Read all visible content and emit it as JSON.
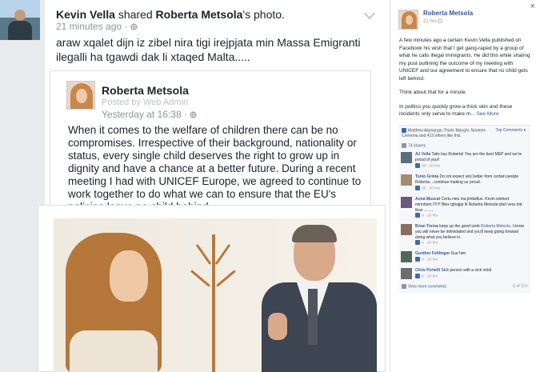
{
  "post": {
    "author": "Kevin Vella",
    "action_prefix": " shared ",
    "shared_from": "Roberta Metsola",
    "action_suffix": "'s photo.",
    "time": "21 minutes ago ·",
    "text": "araw xqalet dijn iz zibel nira tigi irejpjata min Massa Emigranti ilegalli ha tgawdi dak li xtaqed Malta.....",
    "shared": {
      "author": "Roberta Metsola",
      "subtitle": "Posted by Web Admin",
      "time": "Yesterday at 16:38 ·",
      "text": "When it comes to the welfare of children there can be no compromises. Irrespective of their background, nationality or status, every single child deserves the right to grow up in dignity and have a chance at a better future. During a recent meeting I had with UNICEF Europe, we agreed to continue to work together to do what we can to ensure that the EU's policies leave no child behind."
    }
  },
  "panel": {
    "close": "×",
    "author": "Roberta Metsola",
    "time": "21 hrs",
    "p1": "A few minutes ago a certain Kevin Vella published on Facebook his wish that I get gang-raped by a group of what he calls illegal immigrants. He did this while sharing my post outlining the outcome of my meeting with UNICEF and our agreement to ensure that no child gets left behind.",
    "p2": "Think about that for a minute.",
    "p3": "In politics you quickly grow a thick skin and these incidents only serve to make m...",
    "see_more": "See More",
    "likes_text": "Matthew Alamango, Paolo Manghi, Noeleen Cremona and 413 others like this.",
    "top_comments": "Top Comments ▾",
    "shares": "74 shares",
    "comments": [
      {
        "name": "AJ Vella",
        "text": "Tatix kaz Roberta! You are the best MEP and we're proud of you!!",
        "likes": "30",
        "time": "20 hrs"
      },
      {
        "name": "Tonio Grima",
        "text": "Do not expect any better from certain people Roberta....continue making us proud.",
        "likes": "25",
        "time": "20 hrs"
      },
      {
        "name": "Anna Muscat",
        "text": "Certu nies ma jimbidlux. Kevin wiehed minnhom.!!!!!!! Blex tghajjar lil Roberta Metsola zbel vera trid tkun .........",
        "likes": "9",
        "time": "20 hrs"
      },
      {
        "name": "Brian Tonna",
        "text": "keep up the good work",
        "link": "Roberta Metsola",
        "text2": ". I know you will never be intimidated and you'll keep going forward doing what you believe in.",
        "likes": "4",
        "time": "20 hrs"
      },
      {
        "name": "Gunther Fehlinger",
        "text": "Sue him",
        "likes": "9",
        "time": "20 hrs"
      },
      {
        "name": "Chris Portelli",
        "text": "Sick person with a sick mind",
        "likes": "8",
        "time": "20 hrs"
      }
    ],
    "like_label": "Like",
    "reply_label": "Reply",
    "view_more": "View more comments",
    "count": "6 of 114"
  },
  "colors": {
    "link": "#365899",
    "accent": "#4267b2",
    "muted": "#90949c"
  },
  "icons": [
    "globe-icon",
    "chevron-down-icon",
    "close-icon",
    "like-icon",
    "share-icon"
  ]
}
